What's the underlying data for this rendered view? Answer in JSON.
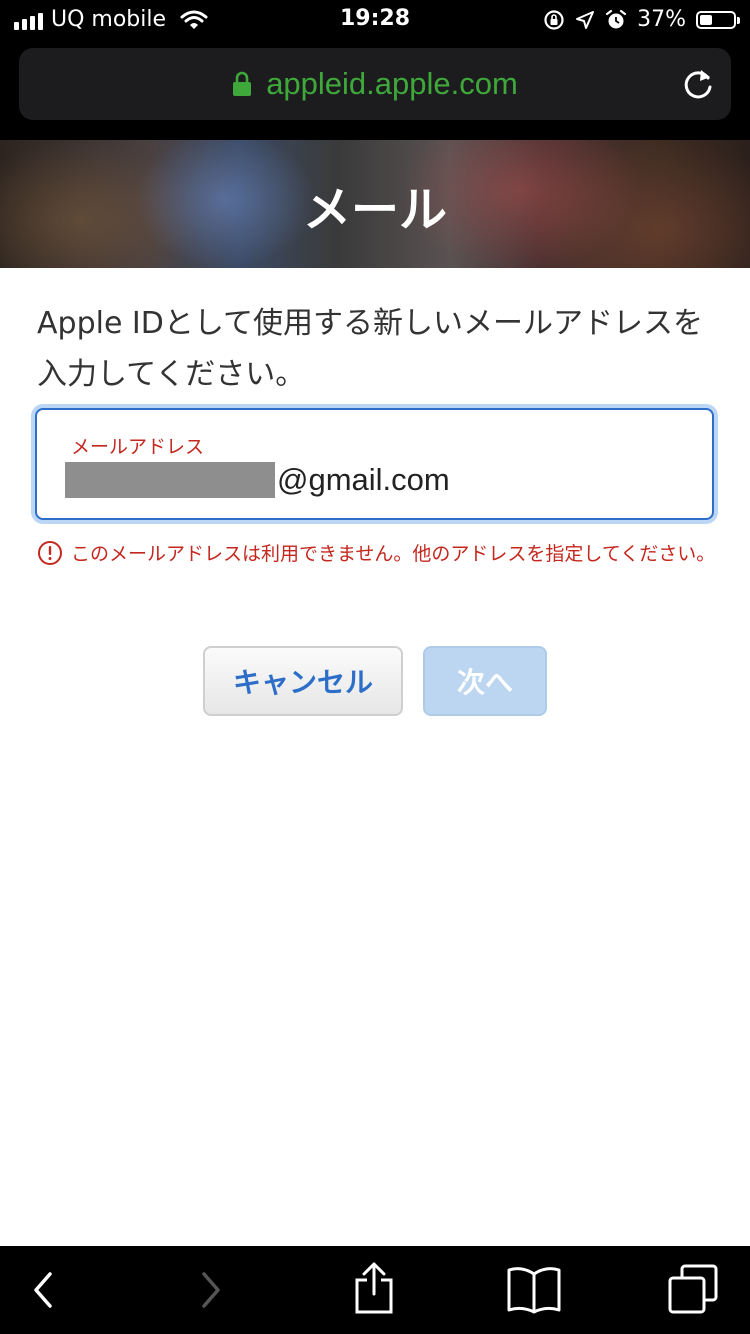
{
  "status_bar": {
    "carrier": "UQ mobile",
    "time": "19:28",
    "battery_percent": "37%",
    "battery_level": 0.37
  },
  "browser": {
    "url": "appleid.apple.com"
  },
  "hero": {
    "title": "メール"
  },
  "form": {
    "instruction": "Apple IDとして使用する新しいメールアドレスを入力してください。",
    "email_label": "メールアドレス",
    "email_domain": "@gmail.com",
    "error_message": "このメールアドレスは利用できません。他のアドレスを指定してください。"
  },
  "buttons": {
    "cancel": "キャンセル",
    "next": "次へ"
  },
  "colors": {
    "url_green": "#3fa83a",
    "error_red": "#c4271e",
    "focus_blue": "#2d6ec9",
    "disabled_button": "#bcd6f2"
  }
}
